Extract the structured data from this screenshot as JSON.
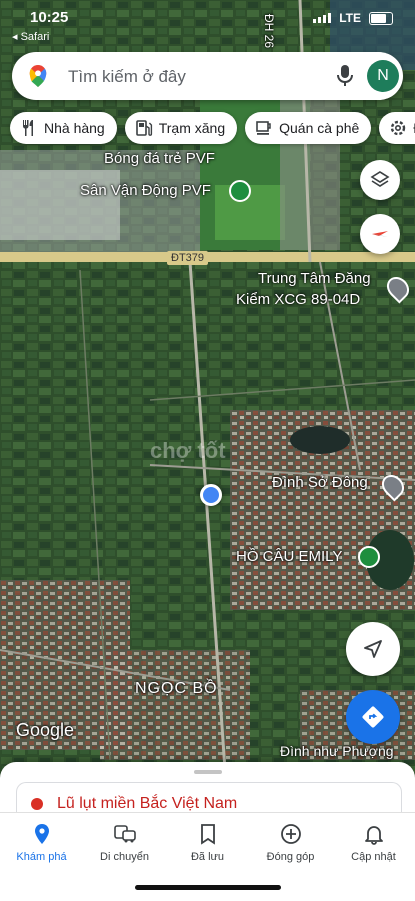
{
  "status_bar": {
    "time": "10:25",
    "back_app": "◂ Safari",
    "network": "LTE"
  },
  "search": {
    "placeholder": "Tìm kiếm ở đây",
    "avatar_letter": "N"
  },
  "chips": [
    {
      "label": "Nhà hàng",
      "icon": "restaurant-icon"
    },
    {
      "label": "Trạm xăng",
      "icon": "gas-station-icon"
    },
    {
      "label": "Quán cà phê",
      "icon": "coffee-icon"
    },
    {
      "label": "Đ",
      "icon": "settings-icon"
    }
  ],
  "map": {
    "labels": {
      "road_vertical": "ĐH 26",
      "place_pvf_1": "Bóng đá trẻ PVF",
      "place_pvf_2": "Sân Vận Động PVF",
      "road_dt379": "ĐT379",
      "trung_tam_1": "Trung Tâm Đăng",
      "trung_tam_2": "Kiểm XCG 89-04D",
      "dinh_so_dong": "Đình Sở Đông",
      "ho_cau": "HỒ CÂU EMILY",
      "ngoc_bo": "NGỌC BỒ",
      "dinh_phuong": "Đình như Phượng",
      "google_logo": "Google"
    },
    "watermark": "chợ tốt"
  },
  "sheet": {
    "alert": "Lũ lụt miền Bắc Việt Nam"
  },
  "bottom_nav": [
    {
      "label": "Khám phá",
      "icon": "explore-pin-icon",
      "active": true
    },
    {
      "label": "Di chuyển",
      "icon": "commute-icon",
      "active": false
    },
    {
      "label": "Đã lưu",
      "icon": "bookmark-icon",
      "active": false
    },
    {
      "label": "Đóng góp",
      "icon": "add-circle-icon",
      "active": false
    },
    {
      "label": "Cập nhật",
      "icon": "bell-icon",
      "active": false
    }
  ],
  "colors": {
    "accent": "#1a73e8",
    "avatar": "#1e7d5b",
    "alert": "#c5221f"
  }
}
